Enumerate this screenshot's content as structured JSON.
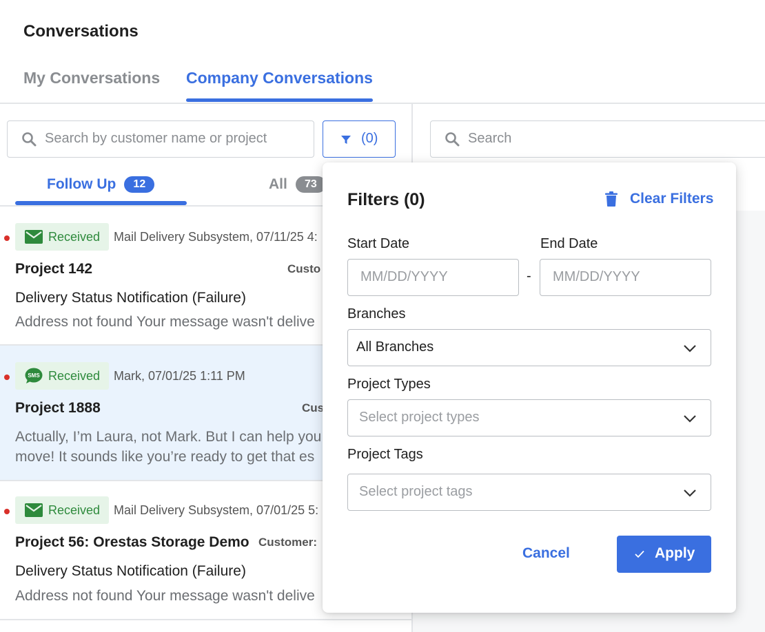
{
  "page": {
    "title": "Conversations"
  },
  "main_tabs": [
    {
      "label": "My Conversations",
      "active": false
    },
    {
      "label": "Company Conversations",
      "active": true
    }
  ],
  "search_left": {
    "placeholder": "Search by customer name or project"
  },
  "filter_button": {
    "count_label": "(0)"
  },
  "search_right": {
    "placeholder": "Search"
  },
  "sub_tabs": [
    {
      "label": "Follow Up",
      "badge": "12",
      "active": true
    },
    {
      "label": "All",
      "badge": "73",
      "active": false
    }
  ],
  "conversations": [
    {
      "status": "Received",
      "channel_icon": "envelope-icon",
      "sender": "Mail Delivery Subsystem, 07/11/25 4:",
      "project": "Project 142",
      "customer": "Custo",
      "subject": "Delivery Status Notification (Failure)",
      "preview": [
        "Address not found Your message wasn't delive"
      ]
    },
    {
      "status": "Received",
      "channel_icon": "sms-icon",
      "sender": "Mark, 07/01/25 1:11 PM",
      "project": "Project 1888",
      "customer": "Cus",
      "subject": "",
      "preview": [
        "Actually, I’m Laura, not Mark. But I can help you",
        "move! It sounds like you’re ready to get that es"
      ]
    },
    {
      "status": "Received",
      "channel_icon": "envelope-icon",
      "sender": "Mail Delivery Subsystem, 07/01/25 5:",
      "project": "Project 56: Orestas Storage Demo",
      "customer": "Customer:",
      "subject": "Delivery Status Notification (Failure)",
      "preview": [
        "Address not found Your message wasn't delive"
      ]
    }
  ],
  "filters_panel": {
    "title": "Filters (0)",
    "clear_label": "Clear Filters",
    "start_date_label": "Start Date",
    "end_date_label": "End Date",
    "date_placeholder": "MM/DD/YYYY",
    "date_separator": "-",
    "branches_label": "Branches",
    "branches_value": "All Branches",
    "project_types_label": "Project Types",
    "project_types_placeholder": "Select project types",
    "project_tags_label": "Project Tags",
    "project_tags_placeholder": "Select project tags",
    "cancel_label": "Cancel",
    "apply_label": "Apply"
  },
  "colors": {
    "accent": "#3a6fe0",
    "received_bg": "#e6f4e8",
    "received_text": "#2e8a3c",
    "unread_dot": "#d9302a",
    "selected_row": "#eaf3fd"
  }
}
